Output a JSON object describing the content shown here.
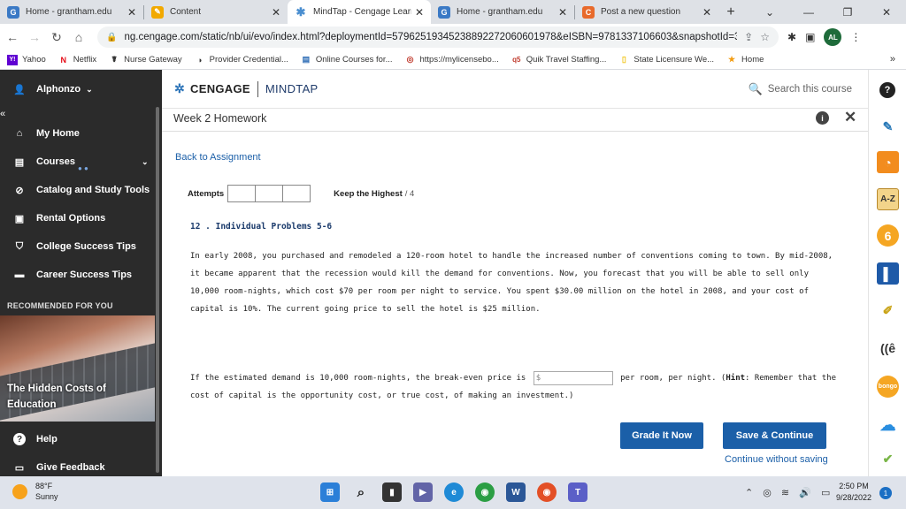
{
  "browser": {
    "tabs": [
      {
        "icon": "G",
        "color": "#3a79c5",
        "title": "Home - grantham.edu"
      },
      {
        "icon": "✎",
        "color": "#f2a900",
        "title": "Content"
      },
      {
        "icon": "✱",
        "color": "#4a8ed0",
        "title": "MindTap - Cengage Learn"
      },
      {
        "icon": "G",
        "color": "#3a79c5",
        "title": "Home - grantham.edu"
      },
      {
        "icon": "C",
        "color": "#e86a2b",
        "title": "Post a new question"
      }
    ],
    "url": "ng.cengage.com/static/nb/ui/evo/index.html?deploymentId=57962519345238892272060601978&eISBN=9781337106603&snapshotId=3152807...",
    "profile_initials": "AL",
    "bookmarks": [
      {
        "icon": "Y!",
        "label": "Yahoo"
      },
      {
        "icon": "N",
        "label": "Netflix"
      },
      {
        "icon": "☤",
        "label": "Nurse Gateway"
      },
      {
        "icon": "◑",
        "label": "Provider Credential..."
      },
      {
        "icon": "▤",
        "label": "Online Courses for..."
      },
      {
        "icon": "◎",
        "label": "https://mylicensebo..."
      },
      {
        "icon": "q5",
        "label": "Quik Travel Staffing..."
      },
      {
        "icon": "▯",
        "label": "State Licensure We..."
      },
      {
        "icon": "★",
        "label": "Home"
      }
    ]
  },
  "sidebar": {
    "user": "Alphonzo",
    "items": [
      {
        "icon": "⌂",
        "label": "My Home"
      },
      {
        "icon": "▤",
        "label": "Courses"
      },
      {
        "icon": "⊘",
        "label": "Catalog and Study Tools"
      },
      {
        "icon": "▣",
        "label": "Rental Options"
      },
      {
        "icon": "🎓",
        "label": "College Success Tips"
      },
      {
        "icon": "▬",
        "label": "Career Success Tips"
      }
    ],
    "recommended_label": "RECOMMENDED FOR YOU",
    "recommended_caption": "The Hidden Costs of Education",
    "bottom": [
      {
        "icon": "?",
        "label": "Help"
      },
      {
        "icon": "▭",
        "label": "Give Feedback"
      }
    ]
  },
  "header": {
    "brand_left": "CENGAGE",
    "brand_right": "MINDTAP",
    "search_placeholder": "Search this course"
  },
  "assignment": {
    "title": "Week 2 Homework",
    "back_link": "Back to Assignment",
    "attempts_label": "Attempts",
    "keep_label": "Keep the Highest",
    "keep_of": "/ 4",
    "problem_title": "12 . Individual Problems 5-6",
    "problem_text": "In early 2008, you purchased and remodeled a 120-room hotel to handle the increased number of conventions coming to town. By mid-2008, it became apparent that the recession would kill the demand for conventions. Now, you forecast that you will be able to sell only 10,000 room-nights, which cost $70 per room per night to service. You spent $30.00 million on the hotel in 2008, and your cost of capital is 10%. The current going price to sell the hotel is $25 million.",
    "question_prefix": "If the estimated demand is 10,000 room-nights, the break-even price is",
    "input_placeholder": "$",
    "question_suffix": "per room, per night. (",
    "hint_label": "Hint",
    "hint_text": ": Remember that the cost of capital is the opportunity cost, or true cost, of making an investment.)",
    "grade_button": "Grade It Now",
    "save_button": "Save & Continue",
    "continue_link": "Continue without saving"
  },
  "taskbar": {
    "temp": "88°F",
    "weather": "Sunny",
    "time": "2:50 PM",
    "date": "9/28/2022",
    "notification_count": "1"
  }
}
